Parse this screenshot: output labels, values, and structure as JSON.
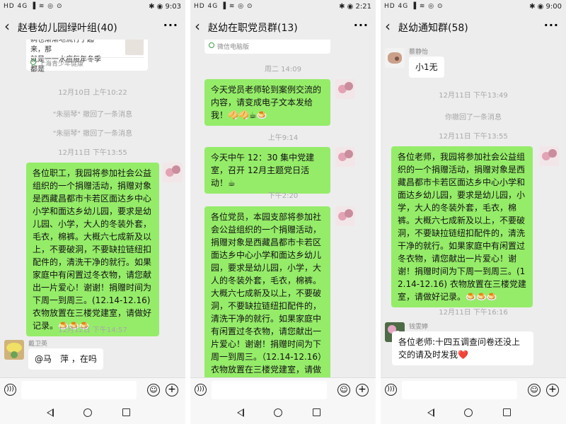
{
  "screens": [
    {
      "status": {
        "left": "HD 4G ▐ ≋ ◎ ⊙",
        "right": "✱ ◉ 9:03"
      },
      "title": "赵巷幼儿园绿叶组(40)",
      "card": {
        "text_line1": "病也渐渐地流行了起来，那",
        "text_line2": "就是一一水痘每年冬季都是",
        "source": "上海青少年健康"
      },
      "timestamps": [
        "12月10日 上午10:22",
        "12月11日 下午13:55",
        "12月12日 下午14:57"
      ],
      "recalls": [
        "\"朱丽琴\" 撤回了一条消息",
        "\"朱丽琴\" 撤回了一条消息"
      ],
      "messages": [
        {
          "text": "各位职工，我园将参加社会公益组织的一个捐赠活动，捐赠对象是西藏昌都市卡若区面达乡中心小学和面达乡幼儿园，要求是幼儿园、小学，大人的冬装外套，毛衣，棉裤。大概六七成新及以上，不要破洞，不要缺拉链纽扣配件的，清洗干净的就行。如果家庭中有闲置过冬衣物，请您献出一片爱心！谢谢！捐赠时间为下周一到周三。(12.14-12.16) 衣物放置在三楼党建室，请做好记录。🍮🍮🍮"
        },
        {
          "sender": "戴卫英",
          "text": "@马　萍 ，在吗"
        }
      ]
    },
    {
      "status": {
        "left": "HD 4G ▐ ≋ ◎ ⊙",
        "right": "✱ ◉ 2:21"
      },
      "title": "赵幼在职党员群(13)",
      "card": {
        "source": "微信电脑版"
      },
      "timestamps": [
        "周二 14:09",
        "上午9:14",
        "下午2:20"
      ],
      "messages": [
        {
          "text": "今天党员老师轮到案例交流的内容，请变成电子文本发给我！🥠🥠☕🍮"
        },
        {
          "text": "今天中午 12：30 集中党建室，召开 12月主题党日活动！☕"
        },
        {
          "text": "各位党员，本园支部将参加社会公益组织的一个捐赠活动，捐赠对象是西藏昌都市卡若区面达乡中心小学和面达乡幼儿园，要求是幼儿园，小学，大人的冬装外套，毛衣，棉裤。大概六七成新及以上，不要破洞，不要缺拉链纽扣配件的，清洗干净的就行。如果家庭中有闲置过冬衣物，请您献出一片爱心！谢谢！捐赠时间为下周一到周三。（12.14-12.16）衣物放置在三楼党建室，请做好记录。🍮🍮🍮"
        }
      ]
    },
    {
      "status": {
        "left": "HD 4G ▐ ≋ ◎ ⊙",
        "right": "✱ ◉ 9:00"
      },
      "title": "赵幼通知群(58)",
      "timestamps": [
        "12月11日 下午13:49",
        "12月11日 下午13:55",
        "12月11日 下午16:16"
      ],
      "recalls": [
        "你撤回了一条消息"
      ],
      "messages": [
        {
          "sender": "蔡静怡",
          "text": "小1无"
        },
        {
          "text": "各位老师，我园将参加社会公益组织的一个捐赠活动，捐赠对象是西藏昌都市卡若区面达乡中心小学和面达乡幼儿园，要求是幼儿园，小学，大人的冬装外套，毛衣，棉裤。大概六七成新及以上，不要破洞，不要缺拉链纽扣配件的，清洗干净的就行。如果家庭中有闲置过冬衣物，请您献出一片爱心！谢谢！捐赠时间为下周一到周三。(12.14-12.16) 衣物放置在三楼党建室，请做好记录。🍮🍮🍮"
        },
        {
          "sender": "钱雯婷",
          "text": "各位老师:十四五调查问卷还没上交的请及时发我❤️"
        }
      ]
    }
  ],
  "icons": {
    "back": "back-arrow-icon",
    "more": "more-dots-icon",
    "voice": "voice-icon",
    "emoji": "emoji-icon",
    "plus": "plus-icon",
    "nav_back": "nav-back-icon",
    "nav_home": "nav-home-icon",
    "nav_recent": "nav-recent-icon"
  },
  "colors": {
    "bubble_self": "#95ec69",
    "bubble_other": "#ffffff",
    "chat_bg": "#ededed",
    "meta_text": "#a8a8a8"
  }
}
